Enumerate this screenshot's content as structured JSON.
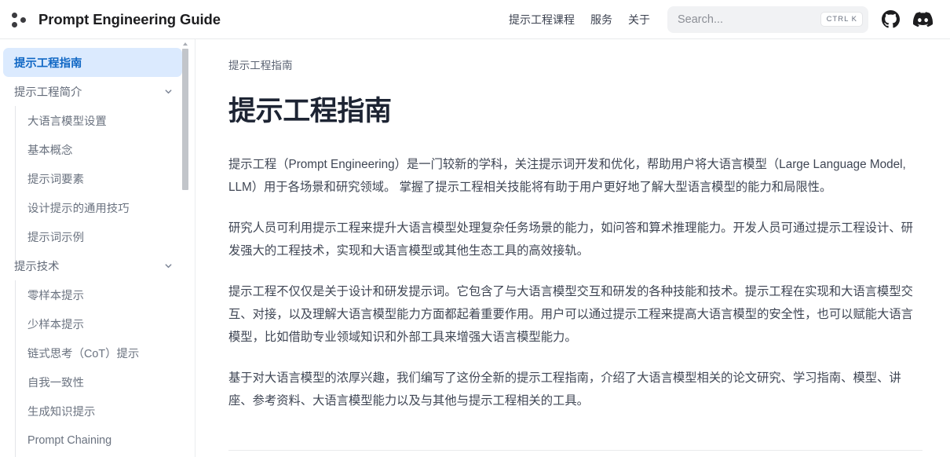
{
  "header": {
    "brand_title": "Prompt Engineering Guide",
    "logo_icon": "three-dots-logo",
    "nav_links": [
      {
        "label": "提示工程课程"
      },
      {
        "label": "服务"
      },
      {
        "label": "关于"
      }
    ],
    "search": {
      "placeholder": "Search...",
      "shortcut": "CTRL K",
      "icon": "search-icon"
    },
    "github_icon": "github-icon",
    "discord_icon": "discord-icon"
  },
  "sidebar": {
    "items": [
      {
        "label": "提示工程指南",
        "type": "link",
        "active": true
      },
      {
        "label": "提示工程简介",
        "type": "group",
        "expanded": true,
        "icon": "chevron-down-icon"
      },
      {
        "label": "大语言模型设置",
        "type": "sub"
      },
      {
        "label": "基本概念",
        "type": "sub"
      },
      {
        "label": "提示词要素",
        "type": "sub"
      },
      {
        "label": "设计提示的通用技巧",
        "type": "sub"
      },
      {
        "label": "提示词示例",
        "type": "sub"
      },
      {
        "label": "提示技术",
        "type": "group",
        "expanded": true,
        "icon": "chevron-down-icon"
      },
      {
        "label": "零样本提示",
        "type": "sub"
      },
      {
        "label": "少样本提示",
        "type": "sub"
      },
      {
        "label": "链式思考（CoT）提示",
        "type": "sub"
      },
      {
        "label": "自我一致性",
        "type": "sub"
      },
      {
        "label": "生成知识提示",
        "type": "sub"
      },
      {
        "label": "Prompt Chaining",
        "type": "sub"
      }
    ]
  },
  "main": {
    "breadcrumb": "提示工程指南",
    "title": "提示工程指南",
    "paragraphs": [
      "提示工程（Prompt Engineering）是一门较新的学科，关注提示词开发和优化，帮助用户将大语言模型（Large Language Model, LLM）用于各场景和研究领域。 掌握了提示工程相关技能将有助于用户更好地了解大型语言模型的能力和局限性。",
      "研究人员可利用提示工程来提升大语言模型处理复杂任务场景的能力，如问答和算术推理能力。开发人员可通过提示工程设计、研发强大的工程技术，实现和大语言模型或其他生态工具的高效接轨。",
      "提示工程不仅仅是关于设计和研发提示词。它包含了与大语言模型交互和研发的各种技能和技术。提示工程在实现和大语言模型交互、对接，以及理解大语言模型能力方面都起着重要作用。用户可以通过提示工程来提高大语言模型的安全性，也可以赋能大语言模型，比如借助专业领域知识和外部工具来增强大语言模型能力。",
      "基于对大语言模型的浓厚兴趣，我们编写了这份全新的提示工程指南，介绍了大语言模型相关的论文研究、学习指南、模型、讲座、参考资料、大语言模型能力以及与其他与提示工程相关的工具。"
    ]
  },
  "colors": {
    "accent_blue": "#1067c4",
    "active_bg": "#dbeafe",
    "text_body": "#3f4654",
    "title": "#1d2433",
    "search_bg": "#f1f2f4"
  }
}
